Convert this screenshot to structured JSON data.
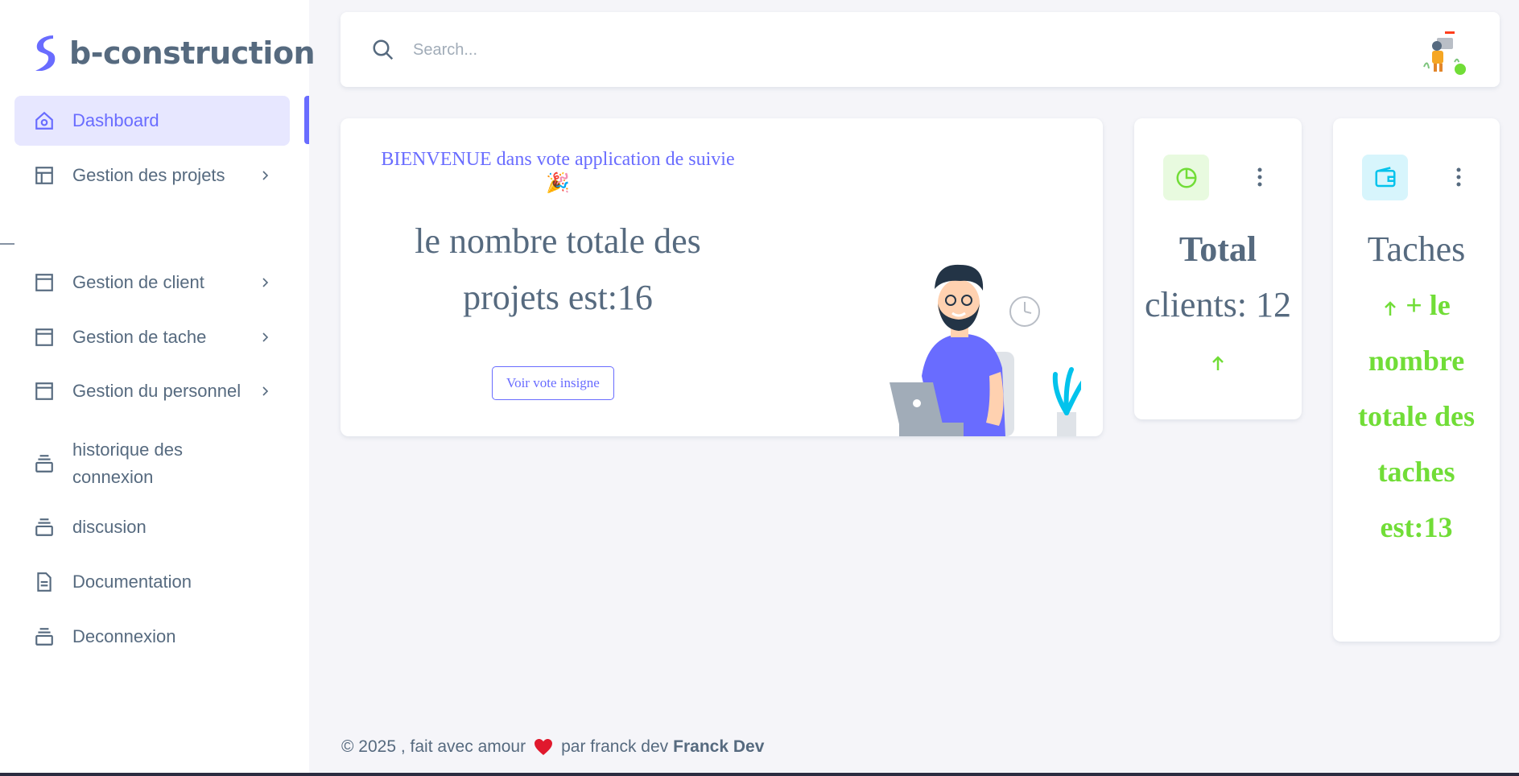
{
  "brand": {
    "name": "b-construction"
  },
  "sidebar": {
    "items": [
      {
        "label": "Dashboard",
        "icon": "home-icon",
        "active": true
      },
      {
        "label": "Gestion des projets",
        "icon": "layout-icon",
        "chevron": true
      },
      {
        "label": "Gestion de client",
        "icon": "window-icon",
        "chevron": true
      },
      {
        "label": "Gestion de tache",
        "icon": "window-icon",
        "chevron": true
      },
      {
        "label": "Gestion du personnel",
        "icon": "window-icon",
        "chevron": true
      },
      {
        "label": "historique des connexion",
        "icon": "collection-icon"
      },
      {
        "label": "discusion",
        "icon": "collection-icon"
      },
      {
        "label": "Documentation",
        "icon": "file-icon"
      },
      {
        "label": "Deconnexion",
        "icon": "collection-icon"
      }
    ]
  },
  "search": {
    "placeholder": "Search..."
  },
  "welcome": {
    "title": "BIENVENUE dans vote application de suivie 🎉",
    "count_text": "le nombre totale des projets est:16",
    "button_label": "Voir vote insigne"
  },
  "stats": {
    "clients": {
      "title": "Total",
      "subtitle": "clients: 12"
    },
    "tasks": {
      "title": "Taches",
      "text": "+ le nombre totale des taches est:13"
    }
  },
  "footer": {
    "text_before": "© 2025 , fait avec amour",
    "text_after": "par franck dev",
    "brand": "Franck Dev"
  },
  "colors": {
    "primary": "#696cff",
    "success": "#71dd37",
    "info": "#03c3ec",
    "text": "#566a7f",
    "background": "#f5f5f9"
  }
}
